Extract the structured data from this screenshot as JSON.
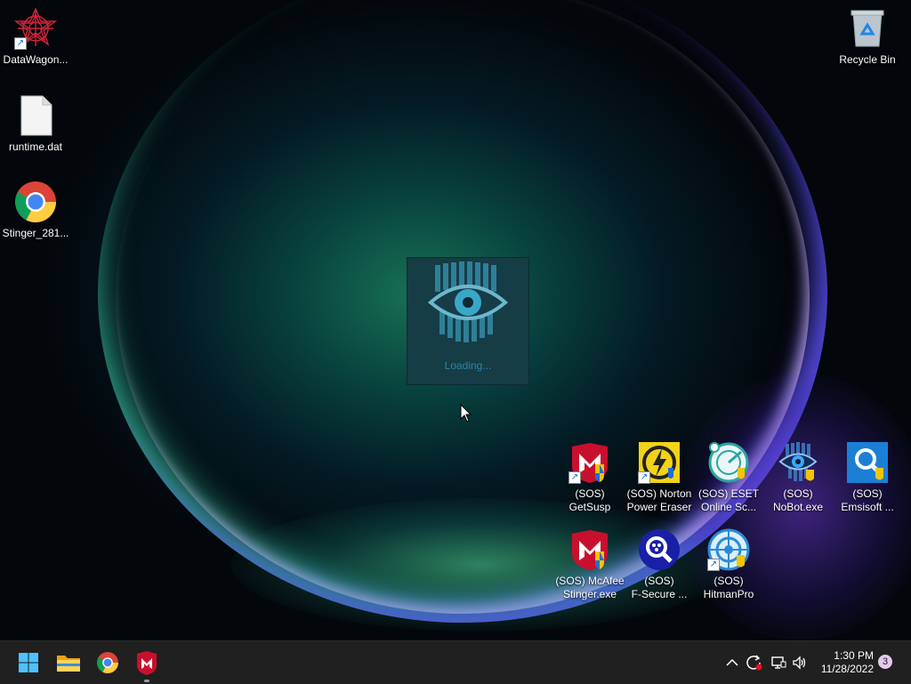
{
  "desktop_icons": [
    {
      "label": "DataWagon..."
    },
    {
      "label": "runtime.dat"
    },
    {
      "label": "Stinger_281..."
    },
    {
      "label": "Recycle Bin"
    },
    {
      "label_line1": "(SOS)",
      "label_line2": "GetSusp"
    },
    {
      "label_line1": "(SOS) Norton",
      "label_line2": "Power Eraser"
    },
    {
      "label_line1": "(SOS) ESET",
      "label_line2": "Online Sc..."
    },
    {
      "label_line1": "(SOS)",
      "label_line2": "NoBot.exe"
    },
    {
      "label_line1": "(SOS)",
      "label_line2": "Emsisoft ..."
    },
    {
      "label_line1": "(SOS) McAfee",
      "label_line2": "Stinger.exe"
    },
    {
      "label_line1": "(SOS)",
      "label_line2": "F-Secure ..."
    },
    {
      "label_line1": "(SOS)",
      "label_line2": "HitmanPro"
    }
  ],
  "splash": {
    "loading_text": "Loading..."
  },
  "taskbar": {
    "apps": [
      "start-button",
      "file-explorer",
      "chrome",
      "mcafee-stinger"
    ],
    "tray_icons": [
      "chevron-up-icon",
      "sync-icon",
      "network-icon",
      "volume-icon"
    ],
    "time": "1:30 PM",
    "date": "11/28/2022",
    "notification_count": "3"
  },
  "colors": {
    "taskbar": "#202020",
    "splash_bg": "#163c46",
    "loading_text": "#2b86a6",
    "mcafee_red": "#c8102e"
  }
}
